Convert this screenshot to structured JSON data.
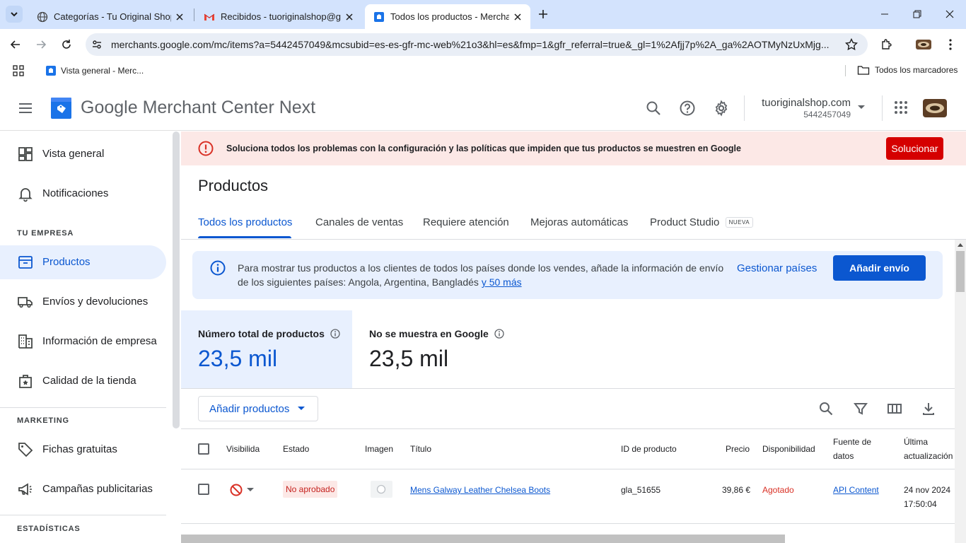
{
  "browser": {
    "tabs": [
      {
        "title": "Categorías - Tu Original Shop",
        "active": false
      },
      {
        "title": "Recibidos - tuoriginalshop@gmail.com",
        "active": false
      },
      {
        "title": "Todos los productos - Merchant Center",
        "active": true
      }
    ],
    "url": "merchants.google.com/mc/items?a=5442457049&mcsubid=es-es-gfr-mc-web%21o3&hl=es&fmp=1&gfr_referral=true&_gl=1%2Afjj7p%2A_ga%2AOTMyNzUxMjg...",
    "bookmarks": {
      "first": "Vista general - Merc...",
      "all": "Todos los marcadores"
    }
  },
  "header": {
    "brand_google": "Google",
    "brand_product": "Merchant Center Next",
    "account_name": "tuoriginalshop.com",
    "account_id": "5442457049"
  },
  "sidebar": {
    "items_top": [
      {
        "label": "Vista general",
        "icon": "dashboard-icon"
      },
      {
        "label": "Notificaciones",
        "icon": "bell-icon"
      }
    ],
    "section_company": "TU EMPRESA",
    "items_company": [
      {
        "label": "Productos",
        "icon": "products-icon",
        "active": true
      },
      {
        "label": "Envíos y devoluciones",
        "icon": "truck-icon"
      },
      {
        "label": "Información de empresa",
        "icon": "building-icon"
      },
      {
        "label": "Calidad de la tienda",
        "icon": "badge-icon"
      }
    ],
    "section_marketing": "MARKETING",
    "items_marketing": [
      {
        "label": "Fichas gratuitas",
        "icon": "tag-icon"
      },
      {
        "label": "Campañas publicitarias",
        "icon": "megaphone-icon"
      }
    ],
    "section_stats": "ESTADÍSTICAS"
  },
  "alert": {
    "text": "Soluciona todos los problemas con la configuración y las políticas que impiden que tus productos se muestren en Google",
    "button": "Solucionar"
  },
  "page": {
    "title": "Productos",
    "tabs": [
      {
        "label": "Todos los productos",
        "active": true
      },
      {
        "label": "Canales de ventas"
      },
      {
        "label": "Requiere atención"
      },
      {
        "label": "Mejoras automáticas"
      },
      {
        "label": "Product Studio",
        "badge": "NUEVA"
      }
    ]
  },
  "info": {
    "text": "Para mostrar tus productos a los clientes de todos los países donde los vendes, añade la información de envío de los siguientes países: Angola, Argentina, Bangladés",
    "more_link": "y 50 más",
    "manage_link": "Gestionar países",
    "add_button": "Añadir envío"
  },
  "stats": [
    {
      "label": "Número total de productos",
      "value": "23,5 mil"
    },
    {
      "label": "No se muestra en Google",
      "value": "23,5 mil"
    }
  ],
  "table": {
    "add_button": "Añadir productos",
    "headers": {
      "visibility": "Visibilida",
      "status": "Estado",
      "image": "Imagen",
      "title": "Título",
      "id": "ID de producto",
      "price": "Precio",
      "availability": "Disponibilidad",
      "source_1": "Fuente de",
      "source_2": "datos",
      "updated_1": "Última",
      "updated_2": "actualización"
    },
    "rows": [
      {
        "status": "No aprobado",
        "title": "Mens Galway Leather Chelsea Boots",
        "id": "gla_51655",
        "price": "39,86 €",
        "availability": "Agotado",
        "source": "API Content",
        "date": "24 nov 2024",
        "time": "17:50:04"
      }
    ]
  },
  "colors": {
    "accent": "#0b57d0",
    "error": "#d93025",
    "error_button": "#d50000",
    "tabstrip": "#d3e3fd"
  }
}
